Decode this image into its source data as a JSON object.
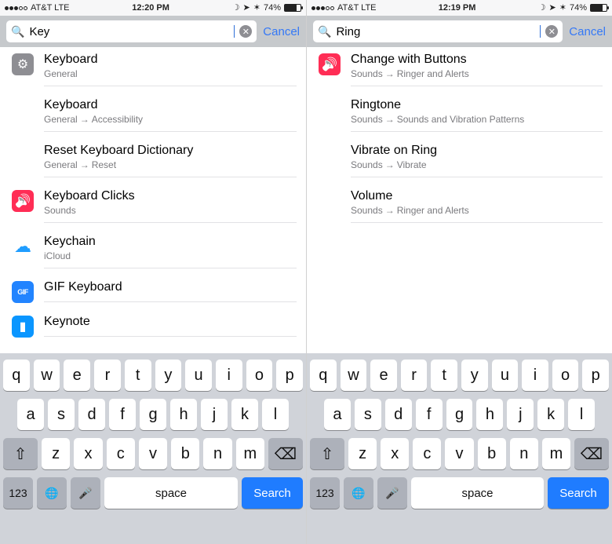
{
  "phones": [
    {
      "status": {
        "carrier": "AT&T  LTE",
        "time": "12:20 PM",
        "dnd": "☽",
        "loc": "➤",
        "bt": "✶",
        "pct": "74%"
      },
      "search": {
        "query": "Key",
        "cancel": "Cancel"
      },
      "results": [
        {
          "icon": "ico-gear",
          "title": "Keyboard",
          "sub": [
            "General"
          ]
        },
        {
          "icon": "",
          "title": "Keyboard",
          "sub": [
            "General",
            "Accessibility"
          ]
        },
        {
          "icon": "",
          "title": "Reset Keyboard Dictionary",
          "sub": [
            "General",
            "Reset"
          ]
        },
        {
          "icon": "ico-speaker",
          "title": "Keyboard Clicks",
          "sub": [
            "Sounds"
          ]
        },
        {
          "icon": "ico-cloud",
          "title": "Keychain",
          "sub": [
            "iCloud"
          ]
        },
        {
          "icon": "ico-gif",
          "title": "GIF Keyboard",
          "sub": []
        },
        {
          "icon": "ico-keynote",
          "title": "Keynote",
          "sub": []
        }
      ]
    },
    {
      "status": {
        "carrier": "AT&T  LTE",
        "time": "12:19 PM",
        "dnd": "☽",
        "loc": "➤",
        "bt": "✶",
        "pct": "74%"
      },
      "search": {
        "query": "Ring",
        "cancel": "Cancel"
      },
      "results": [
        {
          "icon": "ico-speaker",
          "title": "Change with Buttons",
          "sub": [
            "Sounds",
            "Ringer and Alerts"
          ]
        },
        {
          "icon": "",
          "title": "Ringtone",
          "sub": [
            "Sounds",
            "Sounds and Vibration Patterns"
          ]
        },
        {
          "icon": "",
          "title": "Vibrate on Ring",
          "sub": [
            "Sounds",
            "Vibrate"
          ]
        },
        {
          "icon": "",
          "title": "Volume",
          "sub": [
            "Sounds",
            "Ringer and Alerts"
          ]
        }
      ]
    }
  ],
  "keyboard": {
    "row1": [
      "q",
      "w",
      "e",
      "r",
      "t",
      "y",
      "u",
      "i",
      "o",
      "p"
    ],
    "row2": [
      "a",
      "s",
      "d",
      "f",
      "g",
      "h",
      "j",
      "k",
      "l"
    ],
    "row3": [
      "z",
      "x",
      "c",
      "v",
      "b",
      "n",
      "m"
    ],
    "shift": "⇧",
    "backspace": "⌫",
    "num": "123",
    "globe": "🌐",
    "mic": "🎤",
    "space": "space",
    "search": "Search"
  }
}
